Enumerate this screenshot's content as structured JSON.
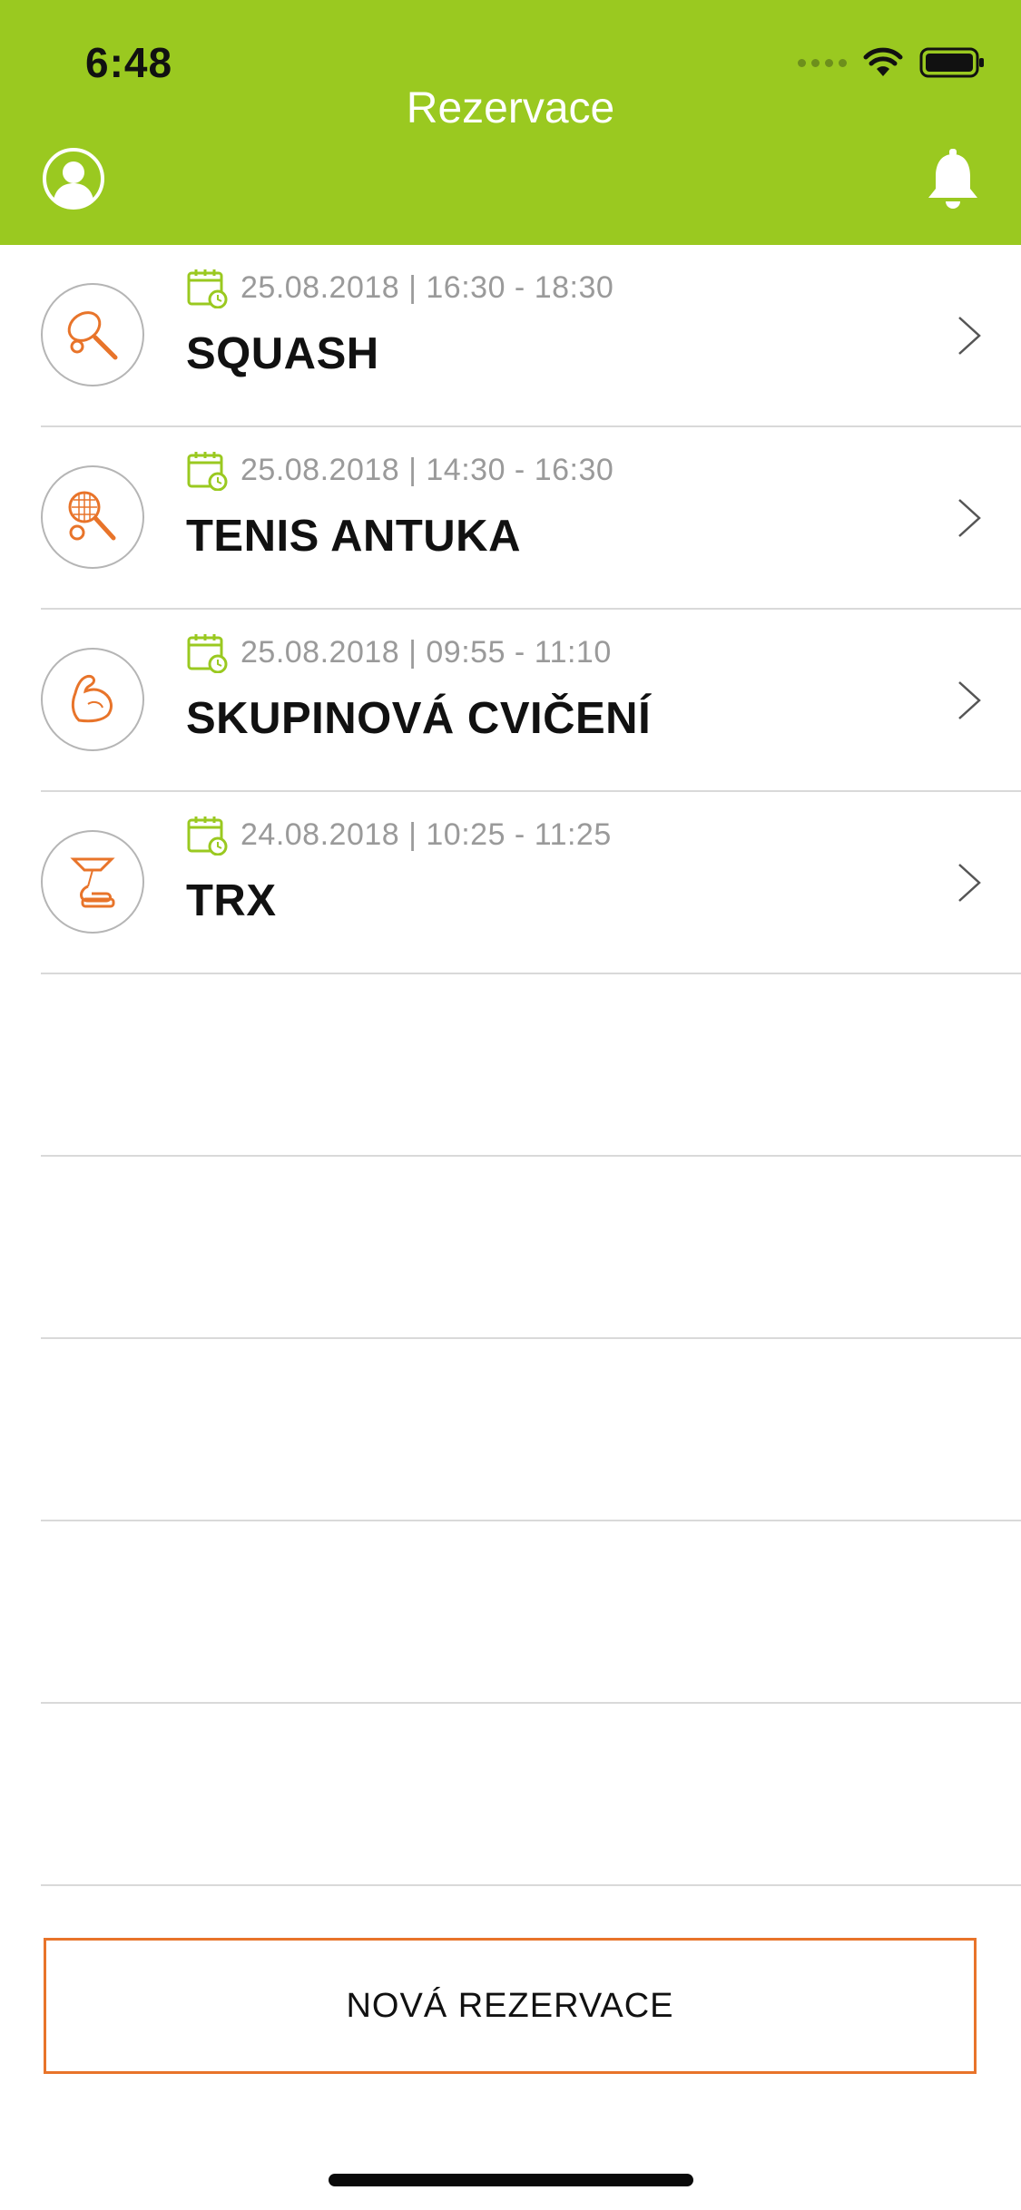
{
  "status_bar": {
    "time": "6:48"
  },
  "header": {
    "title": "Rezervace",
    "icons": {
      "profile": "user-avatar-icon",
      "notifications": "bell-icon"
    }
  },
  "colors": {
    "brand_green": "#9ac920",
    "accent_orange": "#e8742a",
    "date_gray": "#9a9a9a"
  },
  "reservations": [
    {
      "date_time": "25.08.2018 | 16:30 - 18:30",
      "title": "SQUASH",
      "icon": "squash-racket-icon"
    },
    {
      "date_time": "25.08.2018 | 14:30 - 16:30",
      "title": "TENIS ANTUKA",
      "icon": "tennis-racket-icon"
    },
    {
      "date_time": "25.08.2018 | 09:55 - 11:10",
      "title": "SKUPINOVÁ CVIČENÍ",
      "icon": "flexed-arm-icon"
    },
    {
      "date_time": "24.08.2018 | 10:25 - 11:25",
      "title": "TRX",
      "icon": "trx-strap-icon"
    }
  ],
  "footer": {
    "new_reservation_label": "NOVÁ REZERVACE"
  }
}
